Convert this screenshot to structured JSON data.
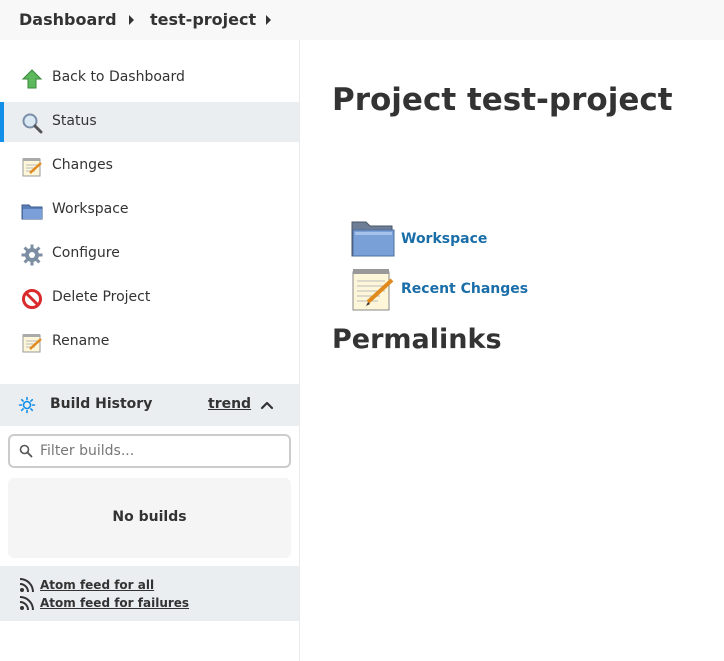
{
  "breadcrumb": {
    "items": [
      {
        "label": "Dashboard"
      },
      {
        "label": "test-project"
      }
    ]
  },
  "sidebar": {
    "tasks": [
      {
        "label": "Back to Dashboard",
        "icon": "up-arrow-icon",
        "active": false
      },
      {
        "label": "Status",
        "icon": "magnifier-icon",
        "active": true
      },
      {
        "label": "Changes",
        "icon": "notepad-icon",
        "active": false
      },
      {
        "label": "Workspace",
        "icon": "folder-icon",
        "active": false
      },
      {
        "label": "Configure",
        "icon": "gear-icon",
        "active": false
      },
      {
        "label": "Delete Project",
        "icon": "no-entry-icon",
        "active": false
      },
      {
        "label": "Rename",
        "icon": "notepad-icon",
        "active": false
      }
    ],
    "build_history": {
      "title": "Build History",
      "trend_label": "trend",
      "filter_placeholder": "Filter builds...",
      "empty_text": "No builds",
      "feeds": [
        {
          "label": "Atom feed for all"
        },
        {
          "label": "Atom feed for failures"
        }
      ]
    }
  },
  "main": {
    "title": "Project test-project",
    "links": [
      {
        "label": "Workspace",
        "icon": "folder-icon"
      },
      {
        "label": "Recent Changes",
        "icon": "notepad-icon"
      }
    ],
    "permalinks_heading": "Permalinks"
  },
  "colors": {
    "accent": "#138fe9",
    "link": "#1a6ea8",
    "sidebar_active_bg": "#ebeef1",
    "breadcrumb_bg": "#f8f8f8"
  }
}
